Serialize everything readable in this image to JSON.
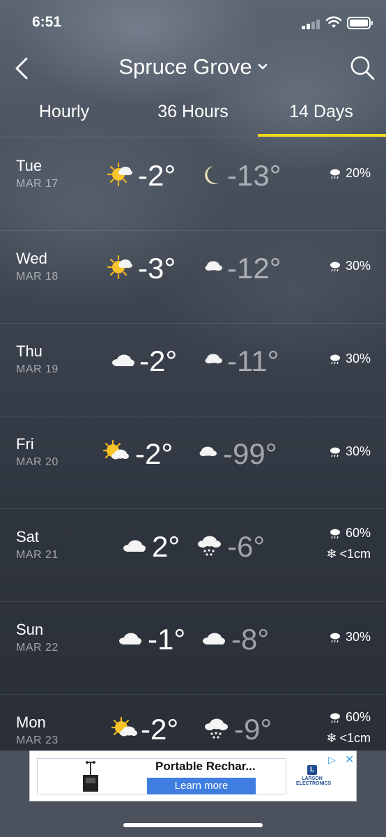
{
  "status_bar": {
    "time": "6:51"
  },
  "header": {
    "location": "Spruce Grove"
  },
  "tabs": [
    {
      "label": "Hourly"
    },
    {
      "label": "36 Hours"
    },
    {
      "label": "14 Days",
      "active": true
    }
  ],
  "days": [
    {
      "day": "Tue",
      "date": "MAR 17",
      "day_icon": "sun-cloud-icon",
      "high": "-2°",
      "night_icon": "moon-icon",
      "low": "-13°",
      "precip": "20%"
    },
    {
      "day": "Wed",
      "date": "MAR 18",
      "day_icon": "sun-cloud-icon",
      "high": "-3°",
      "night_icon": "moon-cloud-icon",
      "low": "-12°",
      "precip": "30%"
    },
    {
      "day": "Thu",
      "date": "MAR 19",
      "day_icon": "cloud-icon",
      "high": "-2°",
      "night_icon": "moon-cloud-icon",
      "low": "-11°",
      "precip": "30%"
    },
    {
      "day": "Fri",
      "date": "MAR 20",
      "day_icon": "sun-cloud-icon",
      "high": "-2°",
      "night_icon": "moon-cloud-icon",
      "low": "-99°",
      "precip": "30%"
    },
    {
      "day": "Sat",
      "date": "MAR 21",
      "day_icon": "cloud-icon",
      "high": "2°",
      "night_icon": "snow-cloud-icon",
      "low": "-6°",
      "precip": "60%",
      "snow": "<1cm"
    },
    {
      "day": "Sun",
      "date": "MAR 22",
      "day_icon": "cloud-icon",
      "high": "-1°",
      "night_icon": "cloud-icon",
      "low": "-8°",
      "precip": "30%"
    },
    {
      "day": "Mon",
      "date": "MAR 23",
      "day_icon": "sun-cloud-icon",
      "high": "-2°",
      "night_icon": "snow-cloud-icon",
      "low": "-9°",
      "precip": "60%",
      "snow": "<1cm"
    }
  ],
  "ad": {
    "title": "Portable Rechar...",
    "cta": "Learn more",
    "brand": "LARSON ELECTRONICS"
  },
  "colors": {
    "accent": "#f2d91c",
    "ad_button": "#3f7de0"
  }
}
